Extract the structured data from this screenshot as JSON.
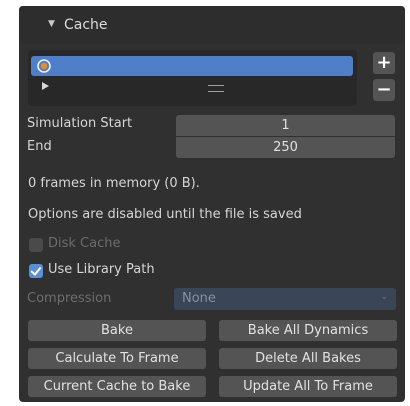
{
  "panel": {
    "title": "Cache"
  },
  "cache_list": {
    "add_label": "+",
    "remove_label": "−"
  },
  "fields": {
    "simulation_start": {
      "label": "Simulation Start",
      "value": "1"
    },
    "end": {
      "label": "End",
      "value": "250"
    }
  },
  "info": {
    "frames_in_memory": "0 frames in memory (0 B).",
    "options_disabled": "Options are disabled until the file is saved"
  },
  "options": {
    "disk_cache": {
      "label": "Disk Cache",
      "checked": false
    },
    "use_library_path": {
      "label": "Use Library Path",
      "checked": true
    },
    "compression": {
      "label": "Compression",
      "value": "None"
    }
  },
  "buttons": {
    "bake": "Bake",
    "bake_all_dynamics": "Bake All Dynamics",
    "calculate_to_frame": "Calculate To Frame",
    "delete_all_bakes": "Delete All Bakes",
    "current_cache_to_bake": "Current Cache to Bake",
    "update_all_to_frame": "Update All To Frame"
  },
  "colors": {
    "panel_bg": "#303030",
    "selected_item": "#4f7fc8",
    "checkbox_on": "#5b8fd6",
    "button_bg": "#545454",
    "disabled_select_bg": "#3a4658"
  }
}
